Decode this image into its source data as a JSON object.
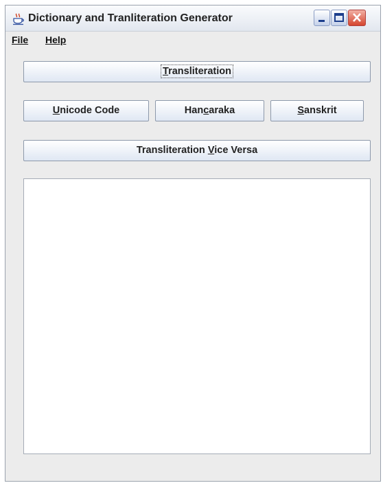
{
  "window": {
    "title": "Dictionary and Tranliteration Generator",
    "title_icon": "java-coffee-cup-icon",
    "controls": [
      "minimize-icon",
      "maximize-icon",
      "close-icon"
    ]
  },
  "menu": {
    "file": "File",
    "help": "Help"
  },
  "buttons": {
    "transliteration": {
      "pre": "",
      "key": "T",
      "post": "ransliteration"
    },
    "unicode_code": {
      "pre": "",
      "key": "U",
      "post": "nicode Code"
    },
    "hancaraka": {
      "pre": "Han",
      "key": "c",
      "post": "araka"
    },
    "sanskrit": {
      "pre": "",
      "key": "S",
      "post": "anskrit"
    },
    "vice_versa": {
      "pre": "Transliteration ",
      "key": "V",
      "post": "ice Versa"
    }
  },
  "output": {
    "value": ""
  },
  "colors": {
    "close_button": "#d5462f",
    "button_gradient_bottom": "#dfe7f3",
    "window_bg": "#ececec"
  }
}
